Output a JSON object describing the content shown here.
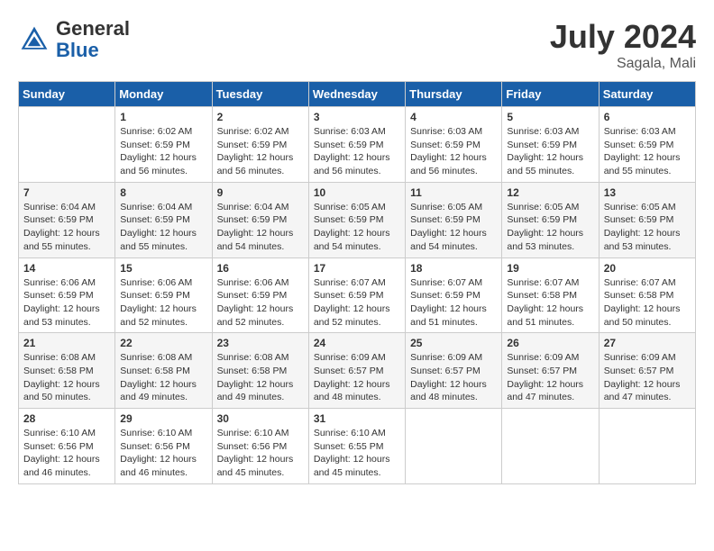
{
  "header": {
    "logo_general": "General",
    "logo_blue": "Blue",
    "month": "July 2024",
    "location": "Sagala, Mali"
  },
  "days_of_week": [
    "Sunday",
    "Monday",
    "Tuesday",
    "Wednesday",
    "Thursday",
    "Friday",
    "Saturday"
  ],
  "weeks": [
    [
      {
        "day": "",
        "sunrise": "",
        "sunset": "",
        "daylight": ""
      },
      {
        "day": "1",
        "sunrise": "6:02 AM",
        "sunset": "6:59 PM",
        "daylight": "12 hours and 56 minutes."
      },
      {
        "day": "2",
        "sunrise": "6:02 AM",
        "sunset": "6:59 PM",
        "daylight": "12 hours and 56 minutes."
      },
      {
        "day": "3",
        "sunrise": "6:03 AM",
        "sunset": "6:59 PM",
        "daylight": "12 hours and 56 minutes."
      },
      {
        "day": "4",
        "sunrise": "6:03 AM",
        "sunset": "6:59 PM",
        "daylight": "12 hours and 56 minutes."
      },
      {
        "day": "5",
        "sunrise": "6:03 AM",
        "sunset": "6:59 PM",
        "daylight": "12 hours and 55 minutes."
      },
      {
        "day": "6",
        "sunrise": "6:03 AM",
        "sunset": "6:59 PM",
        "daylight": "12 hours and 55 minutes."
      }
    ],
    [
      {
        "day": "7",
        "sunrise": "6:04 AM",
        "sunset": "6:59 PM",
        "daylight": "12 hours and 55 minutes."
      },
      {
        "day": "8",
        "sunrise": "6:04 AM",
        "sunset": "6:59 PM",
        "daylight": "12 hours and 55 minutes."
      },
      {
        "day": "9",
        "sunrise": "6:04 AM",
        "sunset": "6:59 PM",
        "daylight": "12 hours and 54 minutes."
      },
      {
        "day": "10",
        "sunrise": "6:05 AM",
        "sunset": "6:59 PM",
        "daylight": "12 hours and 54 minutes."
      },
      {
        "day": "11",
        "sunrise": "6:05 AM",
        "sunset": "6:59 PM",
        "daylight": "12 hours and 54 minutes."
      },
      {
        "day": "12",
        "sunrise": "6:05 AM",
        "sunset": "6:59 PM",
        "daylight": "12 hours and 53 minutes."
      },
      {
        "day": "13",
        "sunrise": "6:05 AM",
        "sunset": "6:59 PM",
        "daylight": "12 hours and 53 minutes."
      }
    ],
    [
      {
        "day": "14",
        "sunrise": "6:06 AM",
        "sunset": "6:59 PM",
        "daylight": "12 hours and 53 minutes."
      },
      {
        "day": "15",
        "sunrise": "6:06 AM",
        "sunset": "6:59 PM",
        "daylight": "12 hours and 52 minutes."
      },
      {
        "day": "16",
        "sunrise": "6:06 AM",
        "sunset": "6:59 PM",
        "daylight": "12 hours and 52 minutes."
      },
      {
        "day": "17",
        "sunrise": "6:07 AM",
        "sunset": "6:59 PM",
        "daylight": "12 hours and 52 minutes."
      },
      {
        "day": "18",
        "sunrise": "6:07 AM",
        "sunset": "6:59 PM",
        "daylight": "12 hours and 51 minutes."
      },
      {
        "day": "19",
        "sunrise": "6:07 AM",
        "sunset": "6:58 PM",
        "daylight": "12 hours and 51 minutes."
      },
      {
        "day": "20",
        "sunrise": "6:07 AM",
        "sunset": "6:58 PM",
        "daylight": "12 hours and 50 minutes."
      }
    ],
    [
      {
        "day": "21",
        "sunrise": "6:08 AM",
        "sunset": "6:58 PM",
        "daylight": "12 hours and 50 minutes."
      },
      {
        "day": "22",
        "sunrise": "6:08 AM",
        "sunset": "6:58 PM",
        "daylight": "12 hours and 49 minutes."
      },
      {
        "day": "23",
        "sunrise": "6:08 AM",
        "sunset": "6:58 PM",
        "daylight": "12 hours and 49 minutes."
      },
      {
        "day": "24",
        "sunrise": "6:09 AM",
        "sunset": "6:57 PM",
        "daylight": "12 hours and 48 minutes."
      },
      {
        "day": "25",
        "sunrise": "6:09 AM",
        "sunset": "6:57 PM",
        "daylight": "12 hours and 48 minutes."
      },
      {
        "day": "26",
        "sunrise": "6:09 AM",
        "sunset": "6:57 PM",
        "daylight": "12 hours and 47 minutes."
      },
      {
        "day": "27",
        "sunrise": "6:09 AM",
        "sunset": "6:57 PM",
        "daylight": "12 hours and 47 minutes."
      }
    ],
    [
      {
        "day": "28",
        "sunrise": "6:10 AM",
        "sunset": "6:56 PM",
        "daylight": "12 hours and 46 minutes."
      },
      {
        "day": "29",
        "sunrise": "6:10 AM",
        "sunset": "6:56 PM",
        "daylight": "12 hours and 46 minutes."
      },
      {
        "day": "30",
        "sunrise": "6:10 AM",
        "sunset": "6:56 PM",
        "daylight": "12 hours and 45 minutes."
      },
      {
        "day": "31",
        "sunrise": "6:10 AM",
        "sunset": "6:55 PM",
        "daylight": "12 hours and 45 minutes."
      },
      {
        "day": "",
        "sunrise": "",
        "sunset": "",
        "daylight": ""
      },
      {
        "day": "",
        "sunrise": "",
        "sunset": "",
        "daylight": ""
      },
      {
        "day": "",
        "sunrise": "",
        "sunset": "",
        "daylight": ""
      }
    ]
  ]
}
